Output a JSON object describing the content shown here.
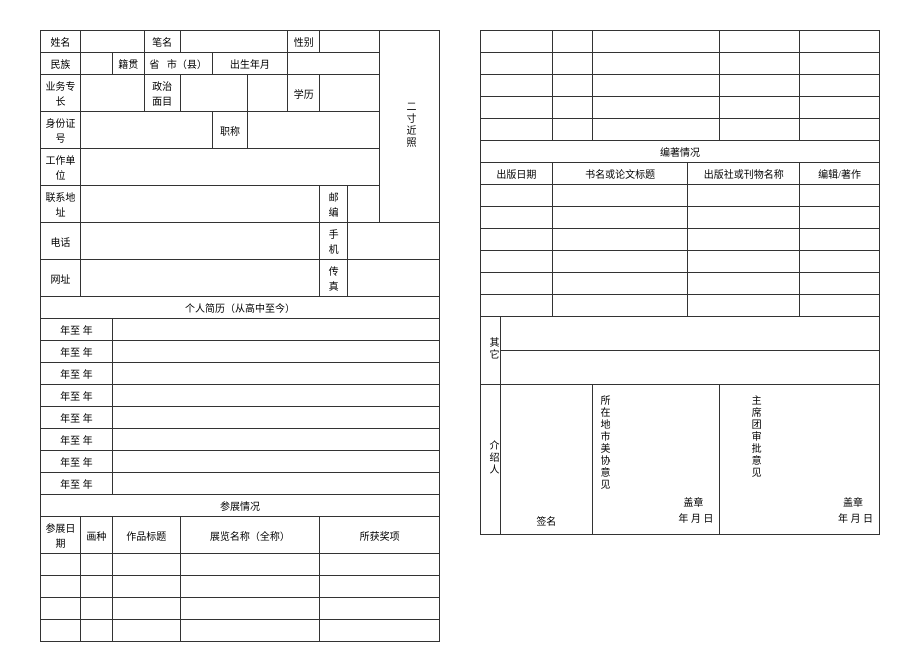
{
  "left": {
    "row1": {
      "name": "姓名",
      "penname": "笔名",
      "gender": "性别"
    },
    "row2": {
      "ethnicity": "民族",
      "origin": "籍贯",
      "province": "省",
      "city": "市（县）",
      "birth": "出生年月"
    },
    "row3": {
      "specialty": "业务专长",
      "political": "政治面目",
      "education": "学历"
    },
    "row4": {
      "idno": "身份证号",
      "title": "职称"
    },
    "row5": {
      "workunit": "工作单位"
    },
    "row6": {
      "address": "联系地址",
      "zip": "邮编"
    },
    "row7": {
      "phone": "电话",
      "mobile": "手机"
    },
    "row8": {
      "url": "网址",
      "fax": "传真"
    },
    "photo": "二寸近照",
    "resume_header": "个人简历（从高中至今）",
    "resume_year": "年至      年",
    "exhibit_header": "参展情况",
    "exhibit_cols": {
      "date": "参展日期",
      "type": "画种",
      "title": "作品标题",
      "name": "展览名称（全称）",
      "award": "所获奖项"
    }
  },
  "right": {
    "pub_header": "编著情况",
    "pub_cols": {
      "date": "出版日期",
      "title": "书名或论文标题",
      "publisher": "出版社或刊物名称",
      "role": "编辑/著作"
    },
    "other": "其它",
    "introducer": "介绍人",
    "signature": "签名",
    "local_opinion": "所在地市美协意见",
    "chair_opinion": "主席团审批意见",
    "stamp": "盖章",
    "date_fmt": "年  月  日"
  }
}
